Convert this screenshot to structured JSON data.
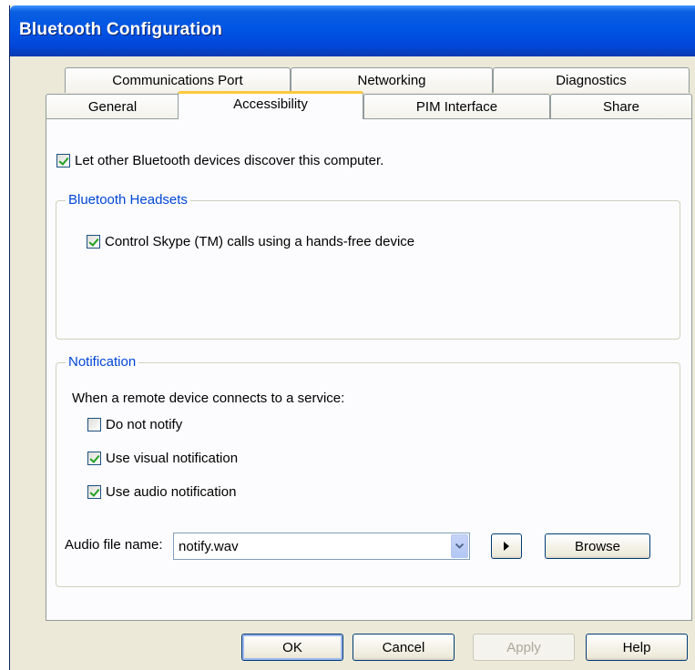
{
  "window": {
    "title": "Bluetooth Configuration"
  },
  "tabs": {
    "row1": [
      "Communications Port",
      "Networking",
      "Diagnostics"
    ],
    "row2": [
      "General",
      "Accessibility",
      "PIM Interface",
      "Share"
    ],
    "active": "Accessibility"
  },
  "discover": {
    "label": "Let other Bluetooth devices discover this computer.",
    "checked": true
  },
  "headsets": {
    "legend": "Bluetooth Headsets",
    "skype": {
      "label": "Control Skype (TM) calls using a hands-free device",
      "checked": true
    }
  },
  "notification": {
    "legend": "Notification",
    "prompt": "When a remote device connects to a service:",
    "options": [
      {
        "label": "Do not notify",
        "checked": false
      },
      {
        "label": "Use visual notification",
        "checked": true
      },
      {
        "label": "Use audio notification",
        "checked": true
      }
    ],
    "audio_label": "Audio file name:",
    "audio_value": "notify.wav",
    "browse_label": "Browse"
  },
  "buttons": {
    "ok": "OK",
    "cancel": "Cancel",
    "apply": "Apply",
    "help": "Help"
  },
  "colors": {
    "accent": "#0046d5",
    "tab_highlight": "#ffc83c",
    "titlebar": "#0055e5",
    "check": "#21a121"
  },
  "icons": {
    "play": "play-icon",
    "dropdown": "chevron-down-icon"
  }
}
